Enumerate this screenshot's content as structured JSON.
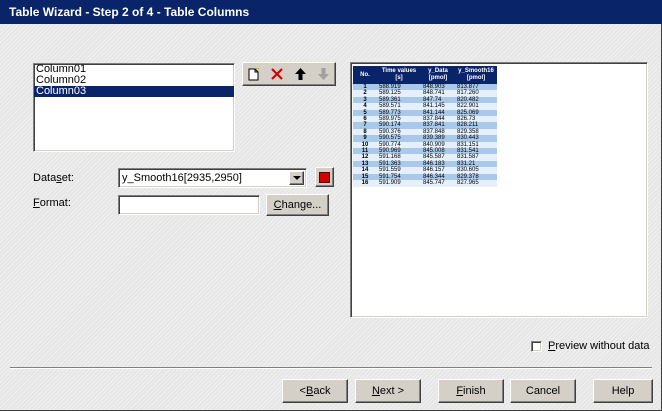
{
  "window": {
    "title": "Table Wizard - Step 2 of 4 - Table Columns"
  },
  "columns_list": {
    "items": [
      {
        "label": "Column01",
        "selected": false
      },
      {
        "label": "Column02",
        "selected": false
      },
      {
        "label": "Column03",
        "selected": true
      }
    ]
  },
  "toolbar": {
    "new_icon": "new-column-icon",
    "delete_icon": "delete-icon",
    "up_icon": "arrow-up-icon",
    "down_icon": "arrow-down-icon"
  },
  "dataset": {
    "label_prefix": "Data",
    "label_key": "s",
    "label_suffix": "et:",
    "value": "y_Smooth16[2935,2950]"
  },
  "format": {
    "label_key": "F",
    "label_suffix": "ormat:",
    "value": ""
  },
  "change_button": {
    "label_key": "C",
    "label_suffix": "hange..."
  },
  "preview_table": {
    "headers": [
      "No.",
      "Time values [s]",
      "y_Data [pmol]",
      "y_Smooth16 [pmol]"
    ],
    "rows": [
      [
        "1",
        "588.919",
        "848.903",
        "813.877"
      ],
      [
        "2",
        "589.125",
        "848.741",
        "817.260"
      ],
      [
        "3",
        "589.361",
        "847.74",
        "820.482"
      ],
      [
        "4",
        "589.571",
        "841.145",
        "822.901"
      ],
      [
        "5",
        "589.773",
        "841.144",
        "825.069"
      ],
      [
        "6",
        "589.975",
        "837.844",
        "826.73"
      ],
      [
        "7",
        "590.174",
        "837.841",
        "828.211"
      ],
      [
        "8",
        "590.376",
        "837.848",
        "829.358"
      ],
      [
        "9",
        "590.575",
        "839.389",
        "830.443"
      ],
      [
        "10",
        "590.774",
        "840.909",
        "831.151"
      ],
      [
        "11",
        "590.969",
        "845.008",
        "831.541"
      ],
      [
        "12",
        "591.168",
        "845.587",
        "831.587"
      ],
      [
        "13",
        "591.363",
        "846.183",
        "831.21"
      ],
      [
        "14",
        "591.559",
        "846.157",
        "830.605"
      ],
      [
        "15",
        "591.754",
        "846.344",
        "829.378"
      ],
      [
        "16",
        "591.909",
        "845.747",
        "827.965"
      ]
    ]
  },
  "preview_checkbox": {
    "label_key": "P",
    "label_suffix": "review without data",
    "checked": false
  },
  "buttons": {
    "back": {
      "prefix": "< ",
      "key": "B",
      "suffix": "ack"
    },
    "next": {
      "key": "N",
      "suffix": "ext >"
    },
    "finish": {
      "key": "F",
      "suffix": "inish"
    },
    "cancel": {
      "label": "Cancel"
    },
    "help": {
      "label": "Help"
    }
  }
}
